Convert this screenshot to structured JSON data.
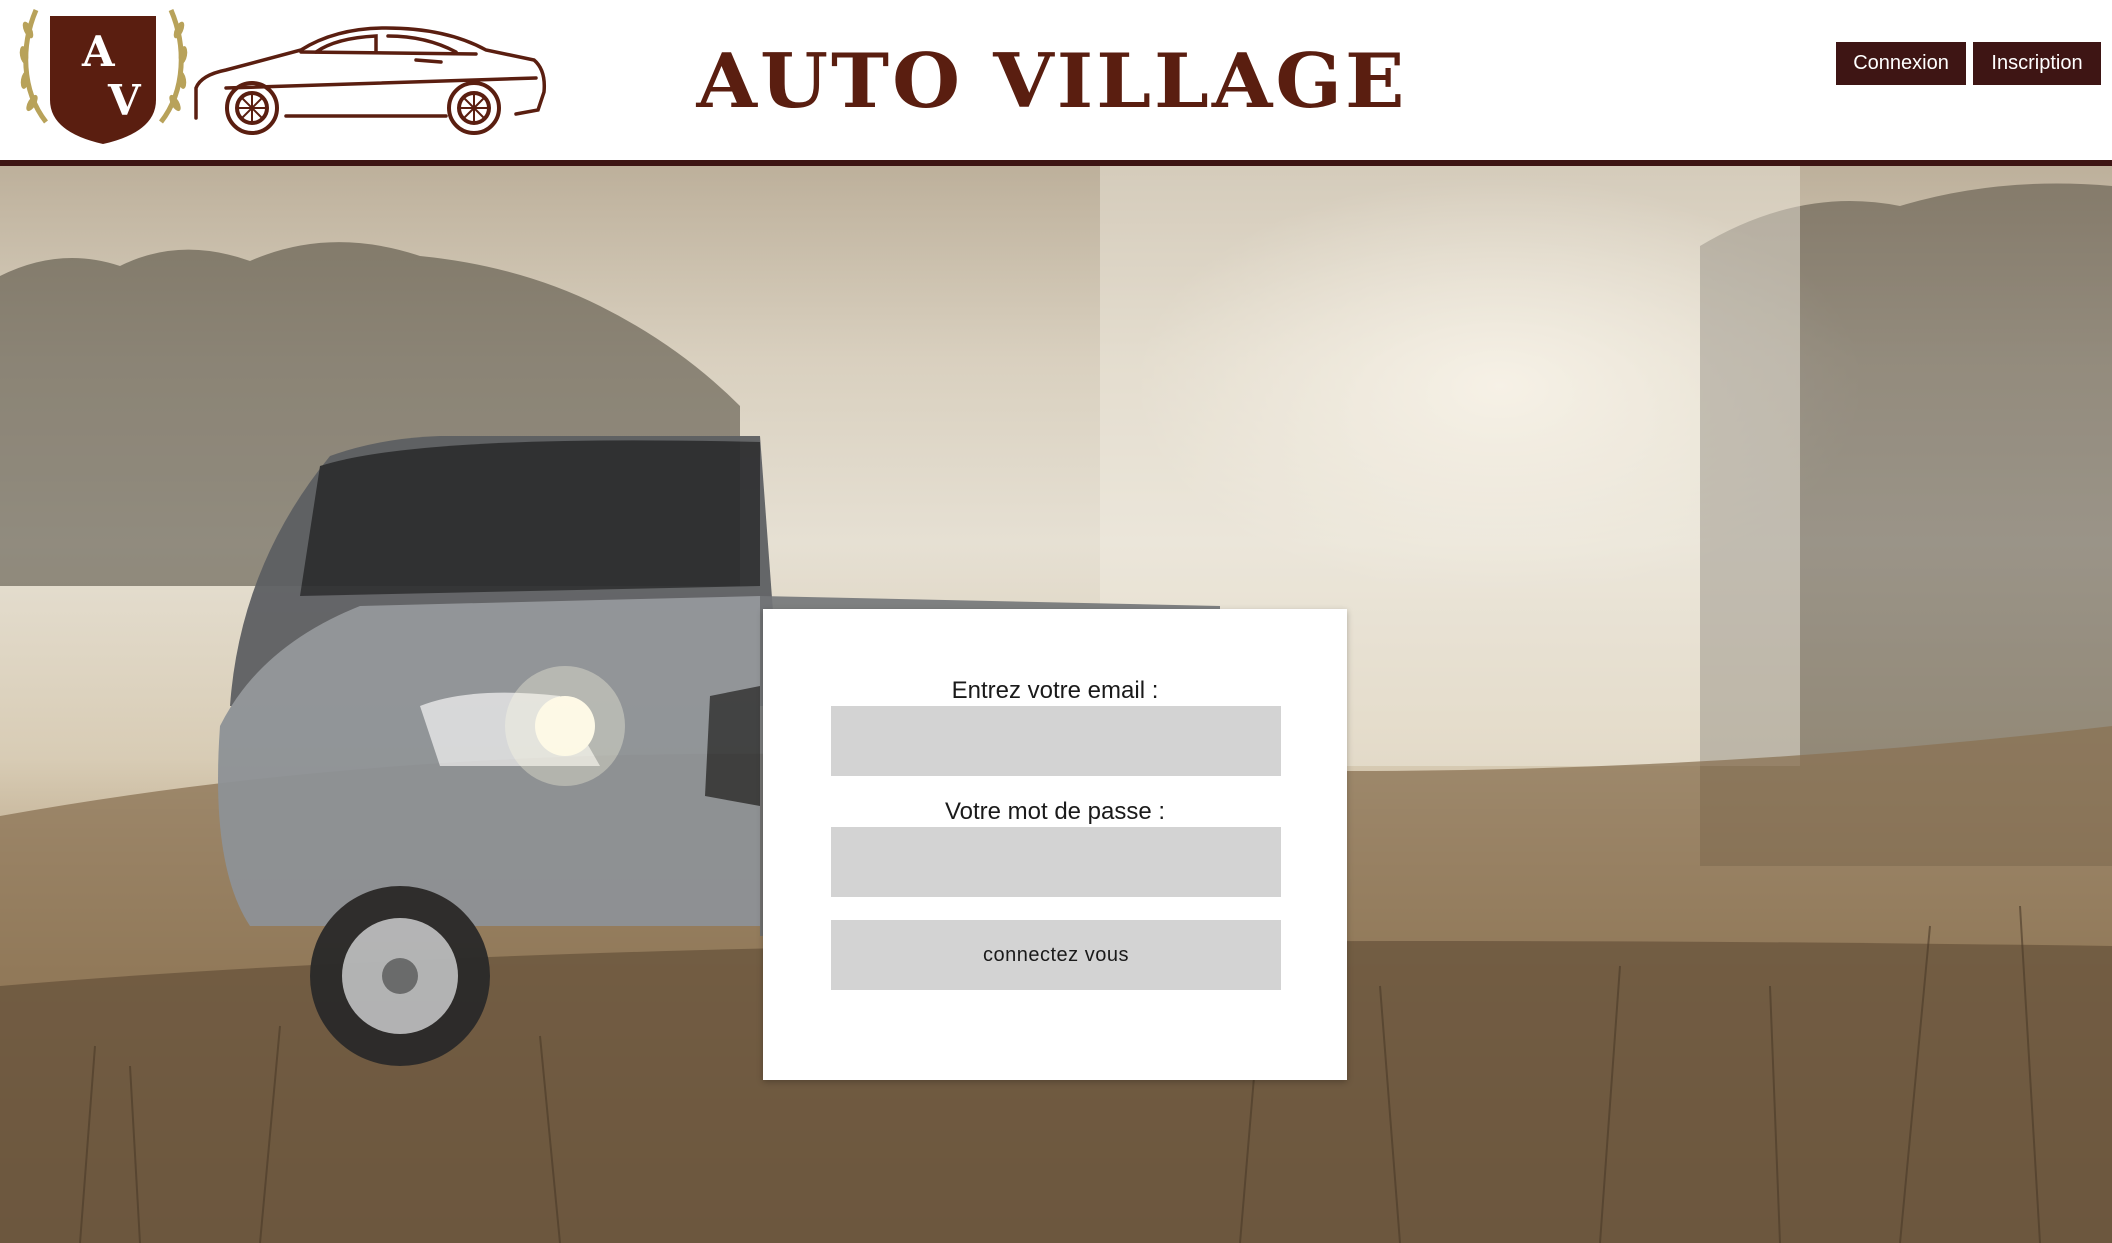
{
  "header": {
    "logo_monogram_top": "A",
    "logo_monogram_bottom": "V",
    "site_title": "AUTO VILLAGE",
    "nav": {
      "connexion_label": "Connexion",
      "inscription_label": "Inscription"
    }
  },
  "login": {
    "email_label": "Entrez votre email :",
    "email_value": "",
    "password_label": "Votre mot de passe :",
    "password_value": "",
    "submit_label": "connectez vous"
  },
  "colors": {
    "brand_dark": "#3e1514",
    "logo_gold": "#b8a25a",
    "input_bg": "#d3d3d3",
    "card_bg": "#ffffff"
  }
}
